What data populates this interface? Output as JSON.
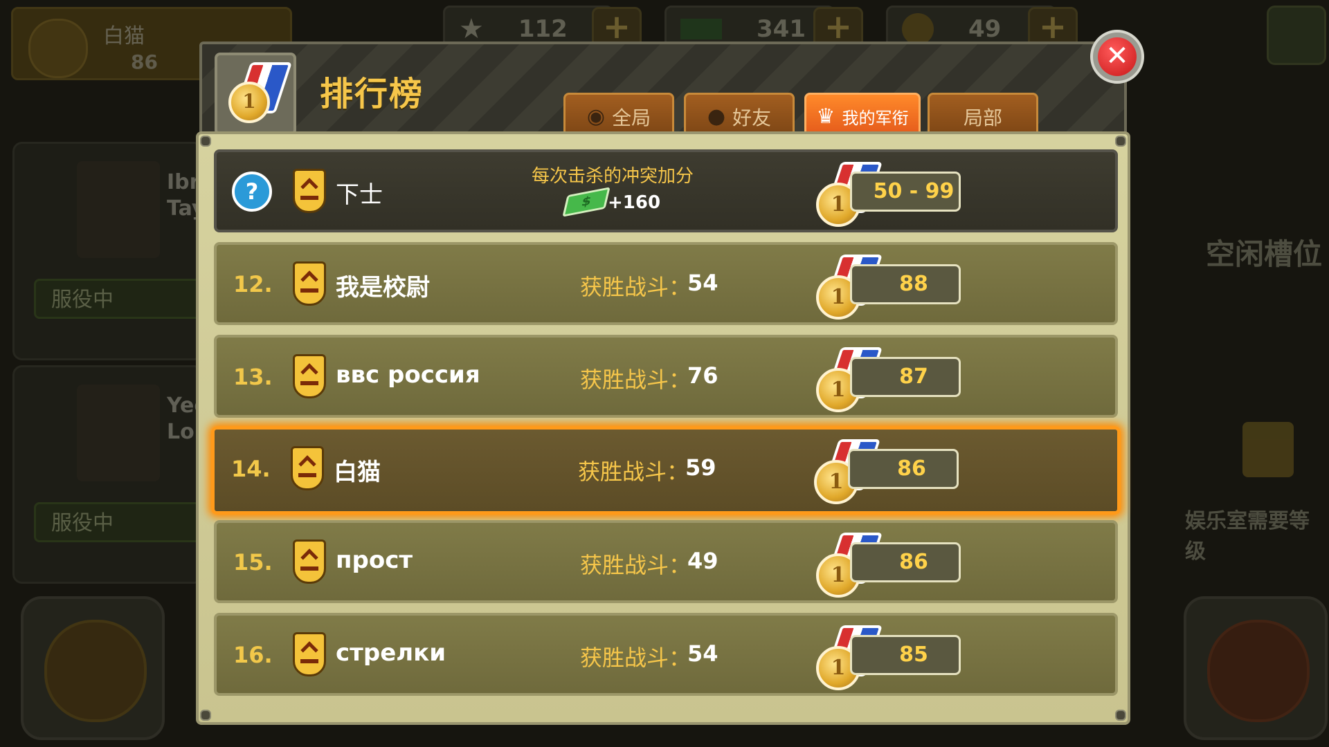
{
  "background": {
    "player_name": "白猫",
    "player_value": "86",
    "resources": [
      {
        "icon": "star-icon",
        "value": "112"
      },
      {
        "icon": "cash-icon",
        "value": "341"
      },
      {
        "icon": "coin-icon",
        "value": "49"
      }
    ],
    "plus_label": "+",
    "units": [
      {
        "name_fragment_1": "Ibra",
        "name_fragment_2": "Tay",
        "status": "服役中"
      },
      {
        "name_fragment_1": "Yec",
        "name_fragment_2": "Lon",
        "status": "服役中"
      }
    ],
    "free_slot": "空闲槽位",
    "rec_room_notice": "娱乐室需要等级"
  },
  "leaderboard": {
    "title": "排行榜",
    "tabs": [
      {
        "label": "全局",
        "icon": "globe-icon",
        "active": false
      },
      {
        "label": "好友",
        "icon": "person-icon",
        "active": false
      },
      {
        "label": "我的军衔",
        "icon": "trophy-icon",
        "active": true
      },
      {
        "label": "局部",
        "icon": "",
        "active": false
      }
    ],
    "close_label": "✕",
    "rank_info": {
      "rank_name": "下士",
      "bonus_label": "每次击杀的冲突加分",
      "bonus_value": "+160",
      "score_range": "50 - 99",
      "help_label": "?"
    },
    "wins_label": "获胜战斗：",
    "medal_label": "1",
    "rows": [
      {
        "rank": "12.",
        "name": "我是校尉",
        "wins": "54",
        "score": "88",
        "highlight": false
      },
      {
        "rank": "13.",
        "name": "ввс россия",
        "wins": "76",
        "score": "87",
        "highlight": false
      },
      {
        "rank": "14.",
        "name": "白猫",
        "wins": "59",
        "score": "86",
        "highlight": true
      },
      {
        "rank": "15.",
        "name": "прост",
        "wins": "49",
        "score": "86",
        "highlight": false
      },
      {
        "rank": "16.",
        "name": "стрелки",
        "wins": "54",
        "score": "85",
        "highlight": false
      }
    ]
  }
}
